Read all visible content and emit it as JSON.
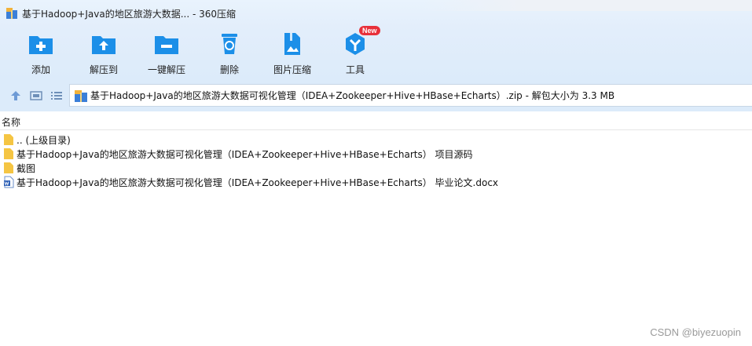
{
  "window": {
    "title": "基于Hadoop+Java的地区旅游大数据... - 360压缩"
  },
  "toolbar": {
    "add_label": "添加",
    "extract_label": "解压到",
    "oneclick_label": "一键解压",
    "delete_label": "删除",
    "image_compress_label": "图片压缩",
    "tools_label": "工具",
    "tools_badge": "New"
  },
  "address": {
    "path": "基于Hadoop+Java的地区旅游大数据可视化管理（IDEA+Zookeeper+Hive+HBase+Echarts）.zip - 解包大小为 3.3 MB"
  },
  "list": {
    "column_name": "名称",
    "items": [
      {
        "name": ".. (上级目录)",
        "type": "parent"
      },
      {
        "name": "基于Hadoop+Java的地区旅游大数据可视化管理（IDEA+Zookeeper+Hive+HBase+Echarts） 项目源码",
        "type": "folder"
      },
      {
        "name": "截图",
        "type": "folder"
      },
      {
        "name": "基于Hadoop+Java的地区旅游大数据可视化管理（IDEA+Zookeeper+Hive+HBase+Echarts） 毕业论文.docx",
        "type": "docx"
      }
    ]
  },
  "watermark": "CSDN @biyezuopin",
  "colors": {
    "accent_blue": "#1c8fe8",
    "folder_yellow": "#f5c543",
    "badge_red": "#e8303a"
  }
}
